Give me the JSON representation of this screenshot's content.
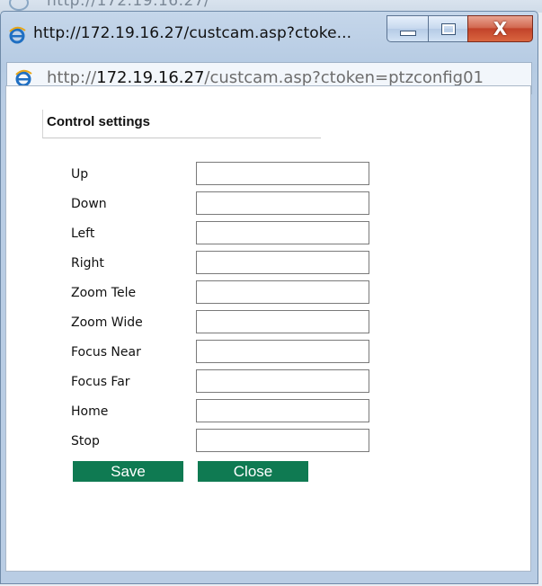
{
  "background_window": {
    "url_fragment": "http://172.19.16.27/"
  },
  "window": {
    "title": "http://172.19.16.27/custcam.asp?ctoke...",
    "close_symbol": "X"
  },
  "address_bar": {
    "scheme": "http://",
    "host": "172.19.16.27",
    "path": "/custcam.asp?ctoken=ptzconfig01"
  },
  "form": {
    "section_title": "Control settings",
    "fields": [
      {
        "label": "Up",
        "value": ""
      },
      {
        "label": "Down",
        "value": ""
      },
      {
        "label": "Left",
        "value": ""
      },
      {
        "label": "Right",
        "value": ""
      },
      {
        "label": "Zoom Tele",
        "value": ""
      },
      {
        "label": "Zoom Wide",
        "value": ""
      },
      {
        "label": "Focus Near",
        "value": ""
      },
      {
        "label": "Focus Far",
        "value": ""
      },
      {
        "label": "Home",
        "value": ""
      },
      {
        "label": "Stop",
        "value": ""
      }
    ],
    "save_label": "Save",
    "close_label": "Close"
  },
  "colors": {
    "button_green": "#0f7a52",
    "titlebar_blue": "#b9cde4",
    "close_red": "#c2432a"
  },
  "icons": [
    "ie-logo-icon",
    "minimize-icon",
    "maximize-icon",
    "close-icon"
  ]
}
